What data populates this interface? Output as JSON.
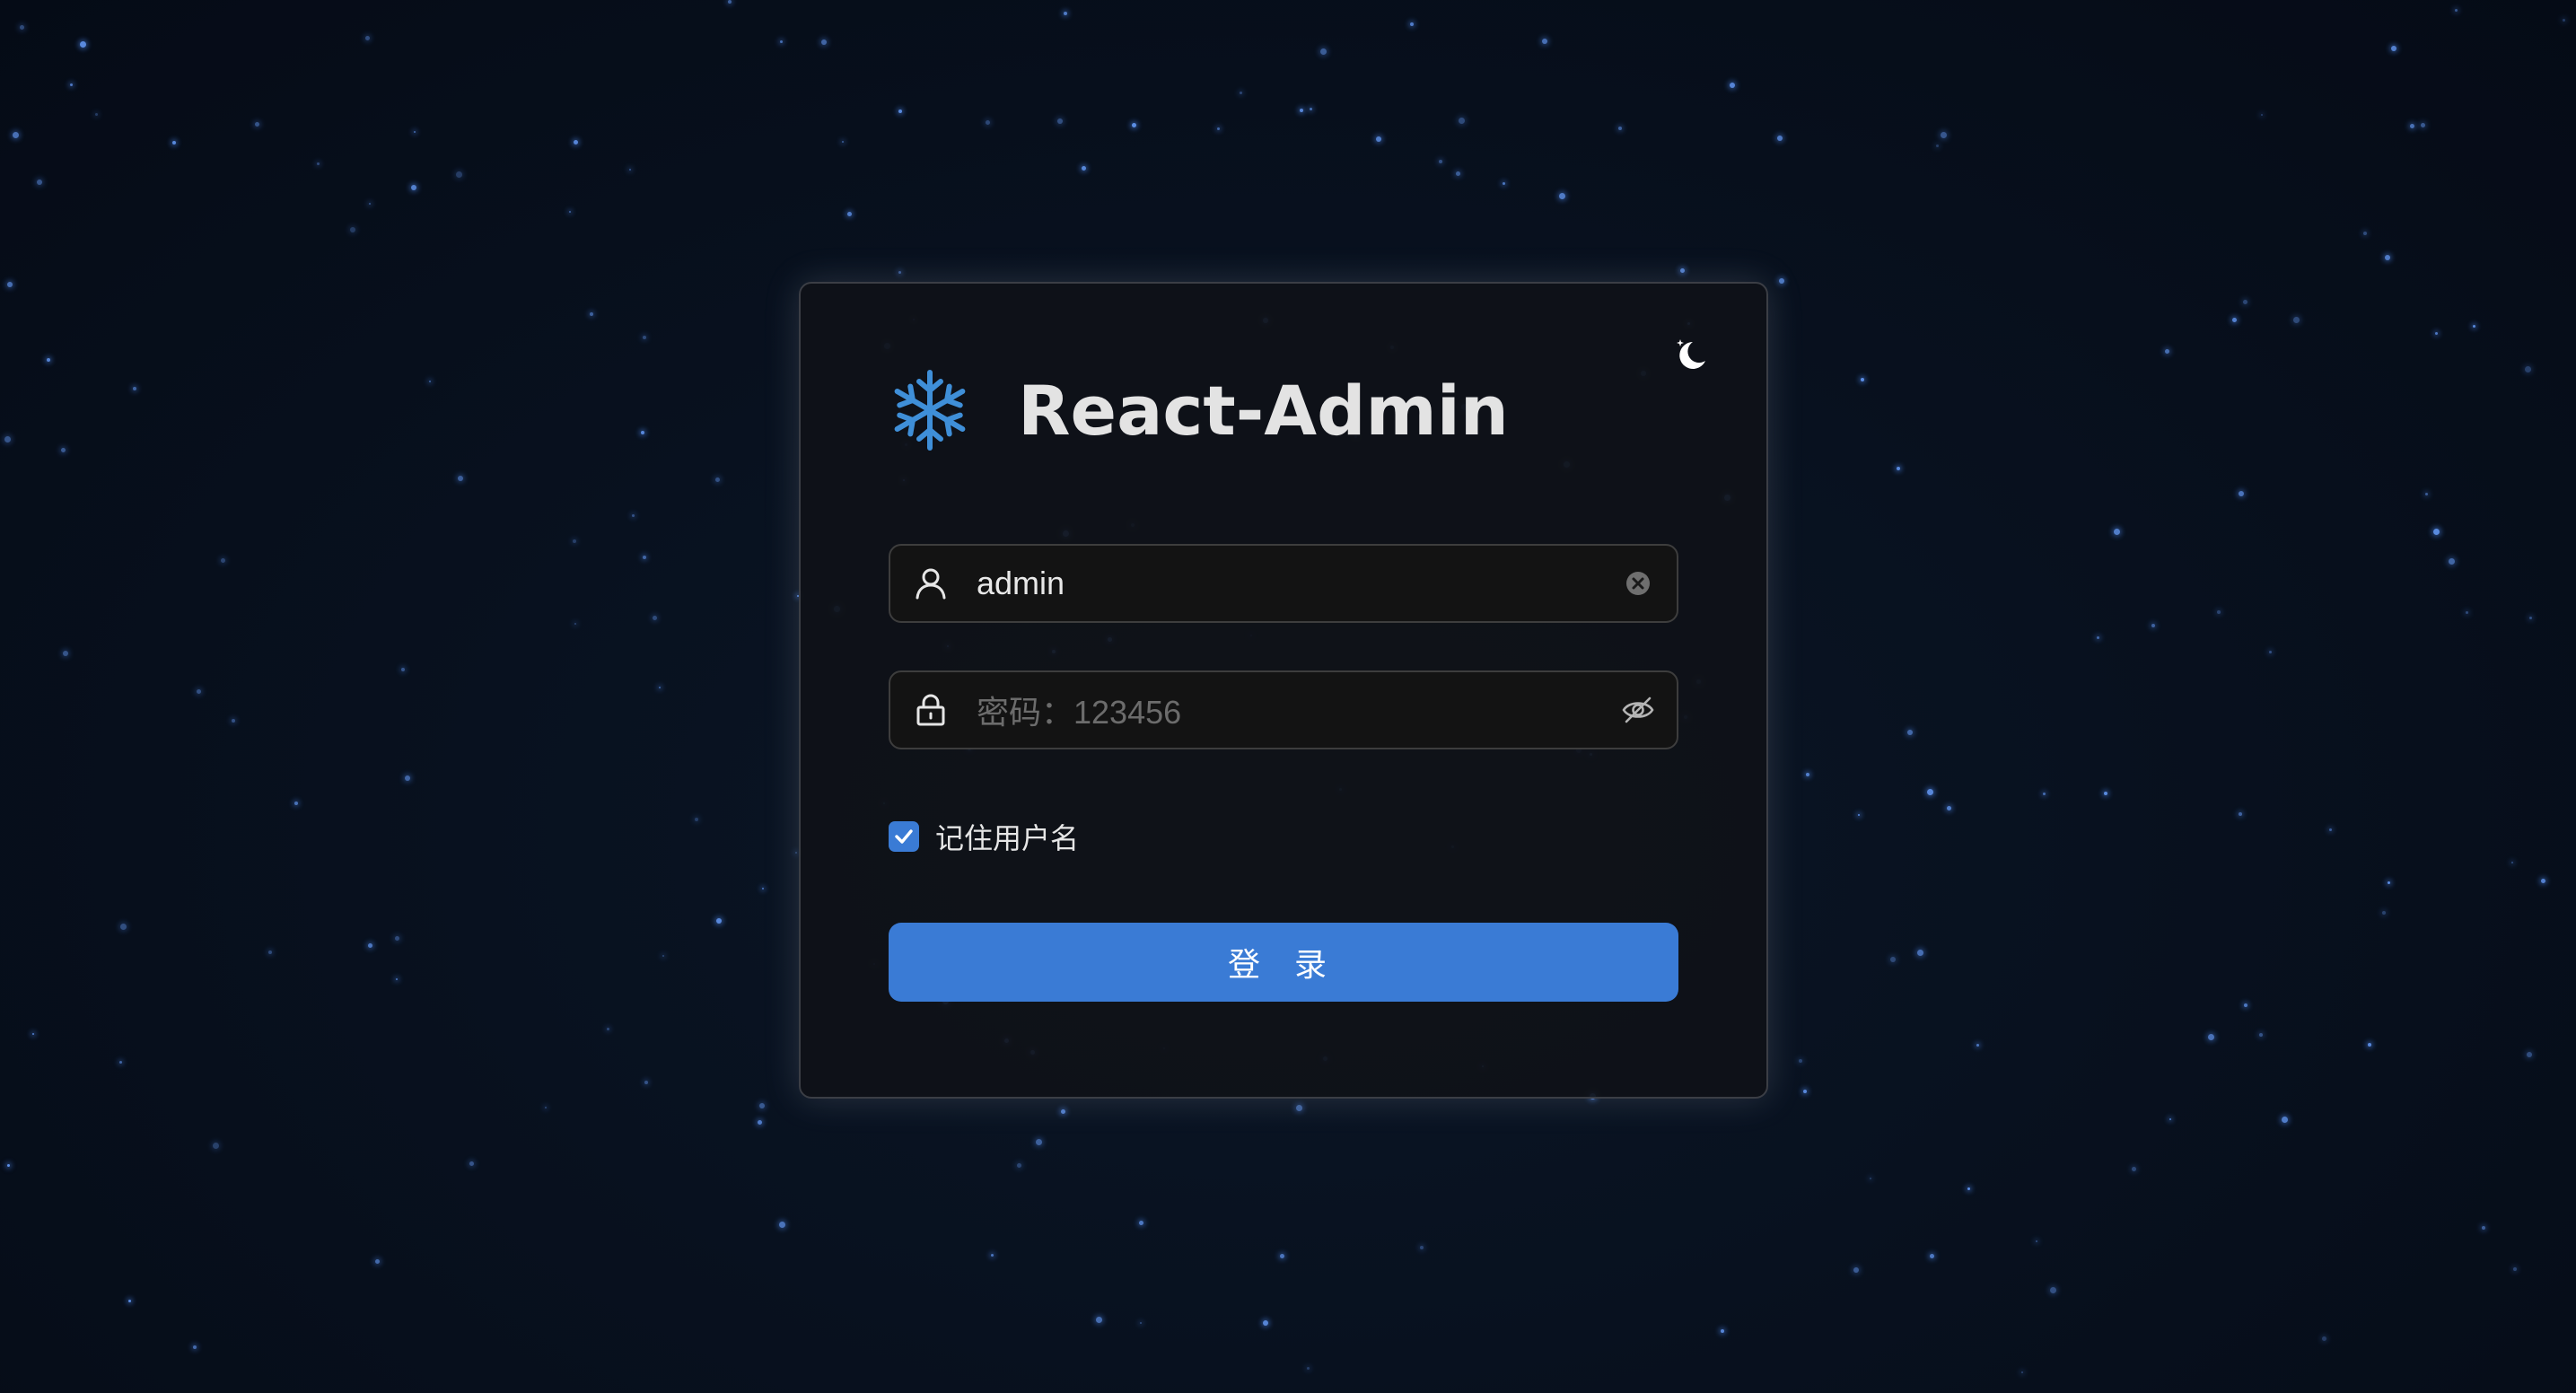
{
  "app": {
    "title": "React-Admin",
    "logo_icon": "snowflake-icon",
    "theme_toggle_icon": "moon-icon"
  },
  "login_form": {
    "username": {
      "value": "admin",
      "prefix_icon": "user-icon",
      "suffix_icon": "clear-circle-icon"
    },
    "password": {
      "value": "",
      "placeholder": "密码：123456",
      "prefix_icon": "lock-icon",
      "suffix_icon": "eye-invisible-icon"
    },
    "remember": {
      "label": "记住用户名",
      "checked": true
    },
    "submit_label": "登 录"
  },
  "colors": {
    "background": "#08111f",
    "star": "#5d8fe6",
    "primary": "#3a7bd5",
    "logo": "#3f8fd8",
    "card": "#101217",
    "card_border": "#3b3e45",
    "title_text": "#e3e3e3"
  }
}
